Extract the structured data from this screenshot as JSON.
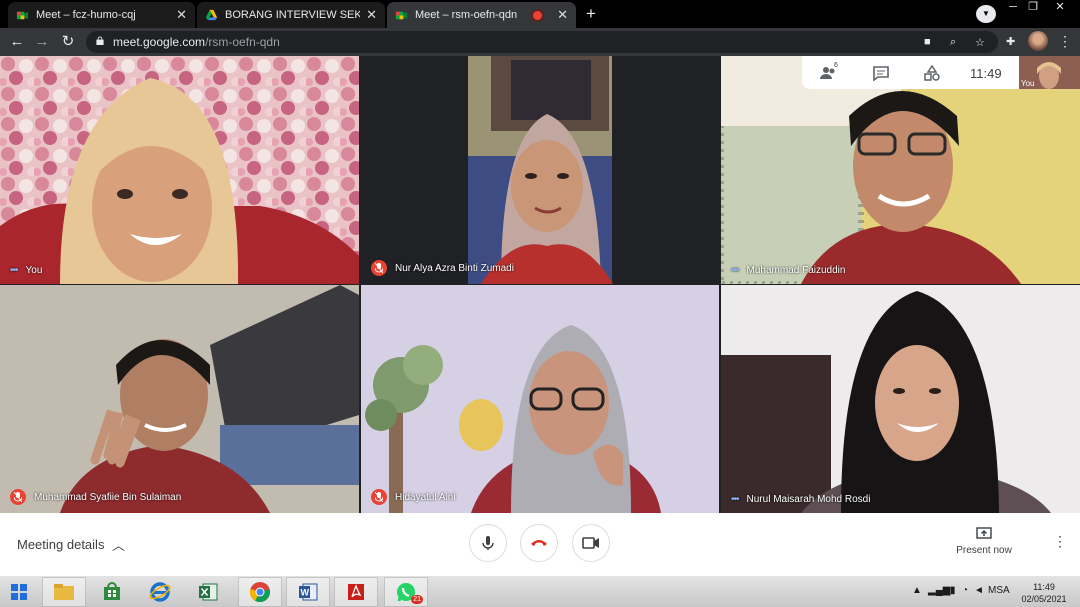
{
  "browser": {
    "tabs": [
      {
        "title": "Meet – fcz-humo-cqj",
        "active": false
      },
      {
        "title": "BORANG INTERVIEW SEKRETARIAT",
        "active": false
      },
      {
        "title": "Meet – rsm-oefn-qdn",
        "active": true
      }
    ],
    "new_tab": "+",
    "url_host": "meet.google.com",
    "url_path": "/rsm-oefn-qdn"
  },
  "meet": {
    "participants": [
      {
        "name": "You",
        "muted": false
      },
      {
        "name": "Nur Alya Azra Binti Zumadi",
        "muted": true
      },
      {
        "name": "Muhammad Faizuddin",
        "muted": false
      },
      {
        "name": "Muhammad Syafiie Bin Sulaiman",
        "muted": true
      },
      {
        "name": "Hidayatul Aini",
        "muted": true
      },
      {
        "name": "Nurul Maisarah Mohd Rosdi",
        "muted": false
      }
    ],
    "people_count": "6",
    "clock": "11:49",
    "self_label": "You",
    "meeting_details": "Meeting details",
    "present_now": "Present now"
  },
  "taskbar": {
    "whatsapp_badge": "21",
    "language": "MSA",
    "time": "11:49",
    "date": "02/05/2021"
  },
  "colors": {
    "accent_blue": "#8ab4f8",
    "mute_red": "#ea4335",
    "chrome_dark": "#35363a"
  }
}
